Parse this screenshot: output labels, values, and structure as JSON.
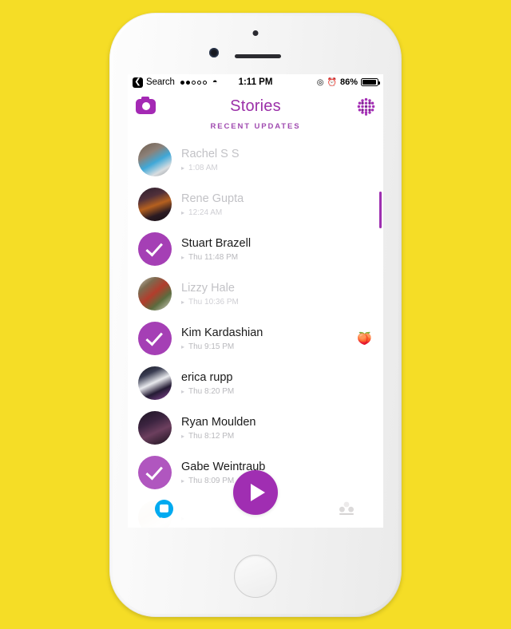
{
  "statusbar": {
    "back_icon": "back-arrow-icon",
    "carrier_label": "Search",
    "signal_filled": 2,
    "signal_total": 5,
    "wifi_icon": "wifi-icon",
    "time": "1:11 PM",
    "location_icon": "location-arrow-icon",
    "alarm_icon": "alarm-clock-icon",
    "battery_percent": "86%"
  },
  "header": {
    "camera_icon": "camera-icon",
    "title": "Stories",
    "grid_icon": "discover-grid-icon",
    "subtitle": "RECENT UPDATES"
  },
  "stories": [
    {
      "name": "Rachel S S",
      "time": "1:08 AM",
      "viewed": true,
      "avatar": "photo",
      "av_class": "av-a",
      "emoji": ""
    },
    {
      "name": "Rene Gupta",
      "time": "12:24 AM",
      "viewed": true,
      "avatar": "photo",
      "av_class": "av-b",
      "emoji": ""
    },
    {
      "name": "Stuart Brazell",
      "time": "Thu 11:48 PM",
      "viewed": false,
      "avatar": "check",
      "av_class": "",
      "emoji": ""
    },
    {
      "name": "Lizzy Hale",
      "time": "Thu 10:36 PM",
      "viewed": true,
      "avatar": "photo",
      "av_class": "av-c",
      "emoji": ""
    },
    {
      "name": "Kim Kardashian",
      "time": "Thu 9:15 PM",
      "viewed": false,
      "avatar": "check",
      "av_class": "",
      "emoji": "🍑"
    },
    {
      "name": "erica rupp",
      "time": "Thu 8:20 PM",
      "viewed": false,
      "avatar": "photo",
      "av_class": "av-d",
      "emoji": ""
    },
    {
      "name": "Ryan Moulden",
      "time": "Thu 8:12 PM",
      "viewed": false,
      "avatar": "photo",
      "av_class": "av-e",
      "emoji": ""
    },
    {
      "name": "Gabe Weintraub",
      "time": "Thu 8:09 PM",
      "viewed": false,
      "avatar": "check-light",
      "av_class": "",
      "emoji": ""
    },
    {
      "name": "",
      "time": "",
      "viewed": true,
      "avatar": "photo",
      "av_class": "av-f",
      "emoji": ""
    }
  ],
  "meta_icon_glyph": "▸",
  "bottombar": {
    "chat_icon": "chat-bubble-icon",
    "play_icon": "play-button-icon",
    "friends_icon": "friends-group-icon"
  },
  "colors": {
    "background": "#f5dd26",
    "accent_purple": "#a02eb2",
    "title_purple": "#9b30a8",
    "chat_blue": "#00aaf0"
  }
}
